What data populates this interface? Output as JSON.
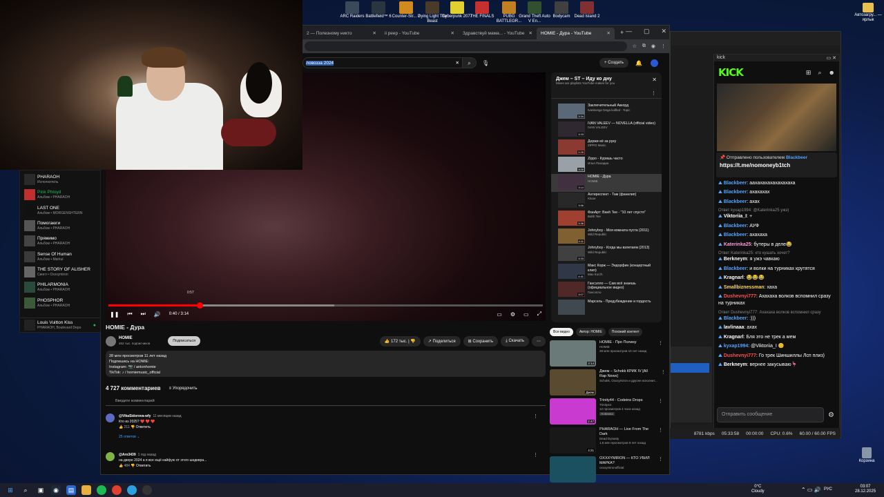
{
  "desktop": {
    "icons": [
      {
        "label": "ARC Raiders",
        "color": "#3a4a5a"
      },
      {
        "label": "Battlefield™ 6",
        "color": "#2a3540"
      },
      {
        "label": "Counter-Str... 2",
        "color": "#d08a20"
      },
      {
        "label": "Dying Light The Beast",
        "color": "#4a3a2a"
      },
      {
        "label": "Cyberpunk 2077",
        "color": "#e0d030"
      },
      {
        "label": "THE FINALS",
        "color": "#c83030"
      },
      {
        "label": "PUBG BATTLEGR...",
        "color": "#c08020"
      },
      {
        "label": "Grand Theft Auto V En...",
        "color": "#305030"
      },
      {
        "label": "Bodycam",
        "color": "#404040"
      },
      {
        "label": "Dead Island 2",
        "color": "#803030"
      }
    ],
    "right_icon": "Автозагру... — ярлык",
    "trash": "Корзина"
  },
  "chrome": {
    "tabs": [
      {
        "title": "2 — Полезному никто"
      },
      {
        "title": "ii peep - YouTube"
      },
      {
        "title": "Здравствуй мама... - YouTube"
      },
      {
        "title": "HOMIE - Дура - YouTube"
      }
    ]
  },
  "youtube": {
    "search": {
      "value": "ловозза 2024"
    },
    "create_label": "Создать",
    "player": {
      "time": "0:40 / 3:14",
      "hover_time": "0:57"
    },
    "video": {
      "title": "HOMIE - Дура",
      "channel": "HOMIE",
      "subs": "462 тыс. подписчиков",
      "subscribe": "Подписаться",
      "likes": "172 тыс.",
      "share": "Поделиться",
      "save": "Сохранить",
      "download": "Скачать"
    },
    "description": [
      "28 млн просмотров  11 лет назад",
      "Подпишись на HOMIE:",
      "Instagram: 📷 / antonhomie",
      "TikTok: ♪ / homiemusic_official"
    ],
    "comments": {
      "count": "4 727 комментариев",
      "sort": "Упорядочить",
      "placeholder": "Введите комментарий",
      "items": [
        {
          "author": "@VikaSidorova-wfy",
          "time": "11 месяцев назад",
          "text": "Кто из 2025? ❤️ ❤️ ❤️",
          "likes": "211",
          "reply": "Ответить",
          "replies": "25 ответов",
          "color": "#5c6bc0"
        },
        {
          "author": "@Aro3439",
          "time": "1 год назад",
          "text": "на дворе 2024 а я все ещё кайфую от этого шедевра...",
          "likes": "484",
          "reply": "Ответить",
          "color": "#7cb342"
        }
      ]
    },
    "playlist": {
      "title": "Джем – ST – Иду ко дну",
      "sub": "Mixes are playlists YouTube makes for you",
      "items": [
        {
          "t": "Заключительный Аккорд",
          "c": "Ivanbongo Dega kollbol - Topic",
          "d": "3:34",
          "col": "#5a6878"
        },
        {
          "t": "IVAN VALEEV — NOVELLA (official video)",
          "c": "IVAN VALEEV",
          "d": "3:33",
          "col": "#302830"
        },
        {
          "t": "Держи её за руку",
          "c": "ZIPPO Music",
          "d": "2:25",
          "col": "#8a3a30"
        },
        {
          "t": "Zippo - Куришь часто",
          "c": "Илья Паладин",
          "d": "3:20",
          "col": "#9aa0a8"
        },
        {
          "t": "HOMIE - Дура",
          "c": "HOMIE",
          "d": "3:14",
          "col": "#403040"
        },
        {
          "t": "Антиреспект - Там (фанклип)",
          "c": "Kluoe",
          "d": "3:56",
          "col": "#282828"
        },
        {
          "t": "ФанАрт: Baнh Tee - \"10 лет спустя\"",
          "c": "Bahh Tee",
          "d": "3:36",
          "col": "#a04030"
        },
        {
          "t": "Johnyboy - Моя комната пуста (2011)",
          "c": "Wild Republic",
          "d": "4:11",
          "col": "#806030"
        },
        {
          "t": "Johnyboy - Когда мы взлетаем (2013)",
          "c": "Wild Republic",
          "d": "3:33",
          "col": "#404040"
        },
        {
          "t": "Макс Корж — Эндорфин (концертный клип)",
          "c": "Max Korzh",
          "d": "4:41",
          "col": "#303848"
        },
        {
          "t": "Гансэлло — Сам всё знаешь (официальное видео)",
          "c": "Гансэлло",
          "d": "3:07",
          "col": "#502828"
        },
        {
          "t": "Марсель - Предубеждение и гордость",
          "c": "",
          "d": "",
          "col": "#404850"
        }
      ]
    },
    "chips": [
      "Все видео",
      "Автор: HOMIE",
      "Похожий контент"
    ],
    "recs": [
      {
        "t": "HOMIE - Про Полину",
        "c": "HOMIE",
        "v": "28 млн просмотров  10 лет назад",
        "d": "3:14",
        "col": "#6a7a78"
      },
      {
        "t": "Джем – Schokk КРИК IV [All Rap News]",
        "c": "Schokk, Охххуmiron и другие исполнит...",
        "v": "",
        "d": "Джем",
        "col": "#5a4a30"
      },
      {
        "t": "Trinity44 - Codeine Drops",
        "c": "Trinity44",
        "v": "12 просмотров  4 часа назад",
        "d": "2:47",
        "col": "#c83ad0",
        "badge": "Новинка"
      },
      {
        "t": "PHARAOH — Live From The Dark",
        "c": "Dead Dynasty",
        "v": "1,5 млн просмотров  9 лет назад",
        "d": "4:21",
        "col": "#181818"
      },
      {
        "t": "OXXXYMIRON — КТО УБИЛ МАРКА?",
        "c": "oxxxymironofficial",
        "v": "",
        "d": "",
        "col": "#1a5060"
      }
    ]
  },
  "spotify": {
    "items": [
      {
        "t": "PHARAOH",
        "s": "Исполнитель"
      },
      {
        "t": "Pink Phloyd",
        "s": "Альбом • PHARAOH",
        "green": true
      },
      {
        "t": "LAST ONE",
        "s": "Альбом • MORGENSHTERN"
      },
      {
        "t": "Помогаюги",
        "s": "Альбом • PHARAOH"
      },
      {
        "t": "Прямимо",
        "s": "Альбом • PHARAOH"
      },
      {
        "t": "Sense Of Human",
        "s": "Альбом • Markul"
      },
      {
        "t": "THE STORY OF ALISHER",
        "s": "Сингл • Oxxxymiron"
      },
      {
        "t": "PHILARMONIA",
        "s": "Альбом • PHARAOH"
      },
      {
        "t": "PHOSPHOR",
        "s": "Альбом • PHARAOH"
      },
      {
        "t": "Louis Vuitton Kiss",
        "s": "PHARAOH, Boulevard Depo"
      }
    ]
  },
  "kick": {
    "window_title": "kick",
    "logo": "KICK",
    "pinned": {
      "by": "Отправлено пользователем",
      "user": "Blackbeer",
      "link": "https://t.me/nomoneyb1tch"
    },
    "messages": [
      {
        "reply": "",
        "user": "Blackbeer",
        "color": "#53a4fc",
        "text": "ааxахахахахахахаха"
      },
      {
        "reply": "",
        "user": "Blackbeer",
        "color": "#53a4fc",
        "text": "ахахахах"
      },
      {
        "reply": "",
        "user": "Blackbeer",
        "color": "#53a4fc",
        "text": "ахах"
      },
      {
        "reply": "Ответ kyxap1994: @Katerinka25 ужэ)",
        "user": "Viktoriia_I",
        "color": "#fff",
        "text": "+"
      },
      {
        "reply": "",
        "user": "Blackbeer",
        "color": "#53a4fc",
        "text": "АУФ"
      },
      {
        "reply": "",
        "user": "Blackbeer",
        "color": "#53a4fc",
        "text": "ахахаха"
      },
      {
        "reply": "",
        "user": "Katerinka25",
        "color": "#ff9ad5",
        "text": "бутеры в деле😂"
      },
      {
        "reply": "Ответ Katerinka25: кто кушать хочет?",
        "user": "Berkneym",
        "color": "#fff",
        "text": "я ужэ чавкаю"
      },
      {
        "reply": "",
        "user": "Blackbeer",
        "color": "#53a4fc",
        "text": "и волки на турниках крутятся"
      },
      {
        "reply": "",
        "user": "Kragnarl",
        "color": "#fff",
        "text": "😂😂😂"
      },
      {
        "reply": "",
        "user": "Smallbiznessman",
        "color": "#ffd84a",
        "text": "хаха"
      },
      {
        "reply": "",
        "user": "Dushevnyi777",
        "color": "#ff5050",
        "text": "Ахахаха волков вспомнил сразу на турниках"
      },
      {
        "reply": "Ответ Dushevnyi777: Ахахаха волков вспомнил сразу",
        "user": "Blackbeer",
        "color": "#53a4fc",
        "text": ":)))"
      },
      {
        "reply": "",
        "user": "lavlinaaa",
        "color": "#fff",
        "text": "ахах"
      },
      {
        "reply": "",
        "user": "Kragnarl",
        "color": "#fff",
        "text": "Бля это не трек а мем"
      },
      {
        "reply": "",
        "user": "kyxap1994",
        "color": "#53a4fc",
        "text": "@Viktoriia_I 😊"
      },
      {
        "reply": "",
        "user": "Dushevnyi777",
        "color": "#ff5050",
        "text": "Го трек Шиншиллы Лсп плиз)"
      },
      {
        "reply": "",
        "user": "Berkneym",
        "color": "#fff",
        "text": "вернее закусываю🦩"
      }
    ],
    "input_placeholder": "Отправить сообщение"
  },
  "obs": {
    "bitrate": "8781 kbps",
    "time1": "05:33:58",
    "time2": "00:00:00",
    "cpu": "CPU: 0.6%",
    "fps": "60.00 / 60.00 FPS"
  },
  "taskbar": {
    "weather_temp": "0°C",
    "weather": "Cloudy",
    "lang": "РУС",
    "time": "03:07",
    "date": "28.12.2025"
  }
}
